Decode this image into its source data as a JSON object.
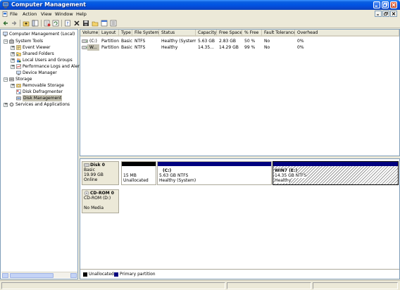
{
  "window": {
    "title": "Computer Management"
  },
  "menu": {
    "items": [
      "File",
      "Action",
      "View",
      "Window",
      "Help"
    ]
  },
  "tree": {
    "root": "Computer Management (Local)",
    "system_tools": "System Tools",
    "event_viewer": "Event Viewer",
    "shared_folders": "Shared Folders",
    "local_users": "Local Users and Groups",
    "perf_logs": "Performance Logs and Alert",
    "device_manager": "Device Manager",
    "storage": "Storage",
    "removable_storage": "Removable Storage",
    "disk_defragmenter": "Disk Defragmenter",
    "disk_management": "Disk Management",
    "services": "Services and Applications"
  },
  "volumes": {
    "headers": [
      "Volume",
      "Layout",
      "Type",
      "File System",
      "Status",
      "Capacity",
      "Free Space",
      "% Free",
      "Fault Tolerance",
      "Overhead"
    ],
    "rows": [
      [
        "(C:)",
        "Partition",
        "Basic",
        "NTFS",
        "Healthy (System)",
        "5.63 GB",
        "2.83 GB",
        "50 %",
        "No",
        "0%"
      ],
      [
        "W...",
        "Partition",
        "Basic",
        "NTFS",
        "Healthy",
        "14.35...",
        "14.29 GB",
        "99 %",
        "No",
        "0%"
      ]
    ]
  },
  "disks": {
    "disk0": {
      "name": "Disk 0",
      "type": "Basic",
      "size": "19.99 GB",
      "status": "Online",
      "partitions": [
        {
          "size": "15 MB",
          "status": "Unallocated"
        },
        {
          "name": "(C:)",
          "size": "5.63 GB NTFS",
          "status": "Healthy (System)"
        },
        {
          "name": "WIN7  (E:)",
          "size": "14.35 GB NTFS",
          "status": "Healthy"
        }
      ]
    },
    "cdrom0": {
      "name": "CD-ROM 0",
      "device": "CD-ROM (D:)",
      "status": "No Media"
    }
  },
  "legend": {
    "unallocated": "Unallocated",
    "primary": "Primary partition"
  },
  "colors": {
    "unallocated": "#000000",
    "primary": "#00007f",
    "selected_bg": "#c6c3b3"
  }
}
